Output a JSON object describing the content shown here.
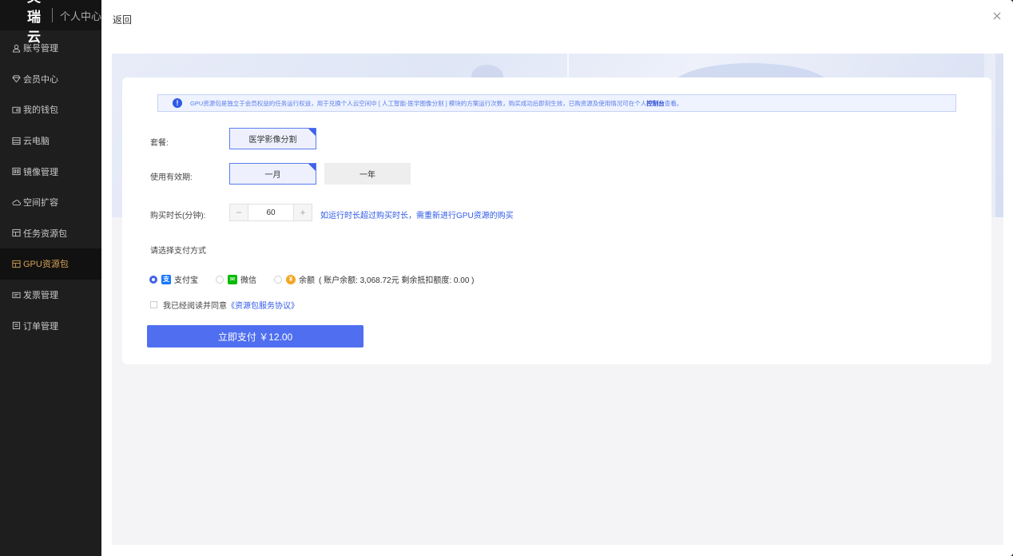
{
  "brand": {
    "name": "英瑞云",
    "subtitle": "个人中心"
  },
  "sidebar": {
    "items": [
      {
        "label": "账号管理",
        "icon": "user-icon"
      },
      {
        "label": "会员中心",
        "icon": "diamond-icon"
      },
      {
        "label": "我的钱包",
        "icon": "wallet-icon"
      },
      {
        "label": "云电脑",
        "icon": "computer-icon"
      },
      {
        "label": "镜像管理",
        "icon": "image-icon"
      },
      {
        "label": "空间扩容",
        "icon": "cloud-icon"
      },
      {
        "label": "任务资源包",
        "icon": "package-icon"
      },
      {
        "label": "GPU资源包",
        "icon": "package-icon",
        "active": true
      },
      {
        "label": "发票管理",
        "icon": "invoice-icon"
      },
      {
        "label": "订单管理",
        "icon": "order-icon"
      }
    ]
  },
  "header": {
    "back_label": "返回"
  },
  "notice": {
    "text": "GPU资源包是独立于会员权益的任务运行权益，用于兑换个人云空间中 [ 人工智能-医学图像分割 ] 模块的方案运行次数，购买成功后即刻生效，已购资源及使用情况可在个人",
    "link": "控制台",
    "suffix": "查看。"
  },
  "form": {
    "package_label": "套餐:",
    "package_option": "医学影像分割",
    "validity_label": "使用有效期:",
    "validity_options": [
      "一月",
      "一年"
    ],
    "duration_label": "购买时长(分钟):",
    "duration_value": "60",
    "minus": "−",
    "plus": "+",
    "duration_hint": "如运行时长超过购买时长，需重新进行GPU资源的购买",
    "payment_label": "请选择支付方式",
    "payment_options": {
      "alipay": "支付宝",
      "wechat": "微信",
      "balance": "余额",
      "balance_detail": "( 账户余额: 3,068.72元 剩余抵扣额度: 0.00 )"
    },
    "agree_text": "我已经阅读并同意",
    "agree_link": "《资源包服务协议》",
    "pay_button": "立即支付 ￥12.00"
  },
  "colors": {
    "accent": "#4f6ff0",
    "sidebar_bg": "#1e1e1e",
    "active_text": "#d6a255"
  }
}
